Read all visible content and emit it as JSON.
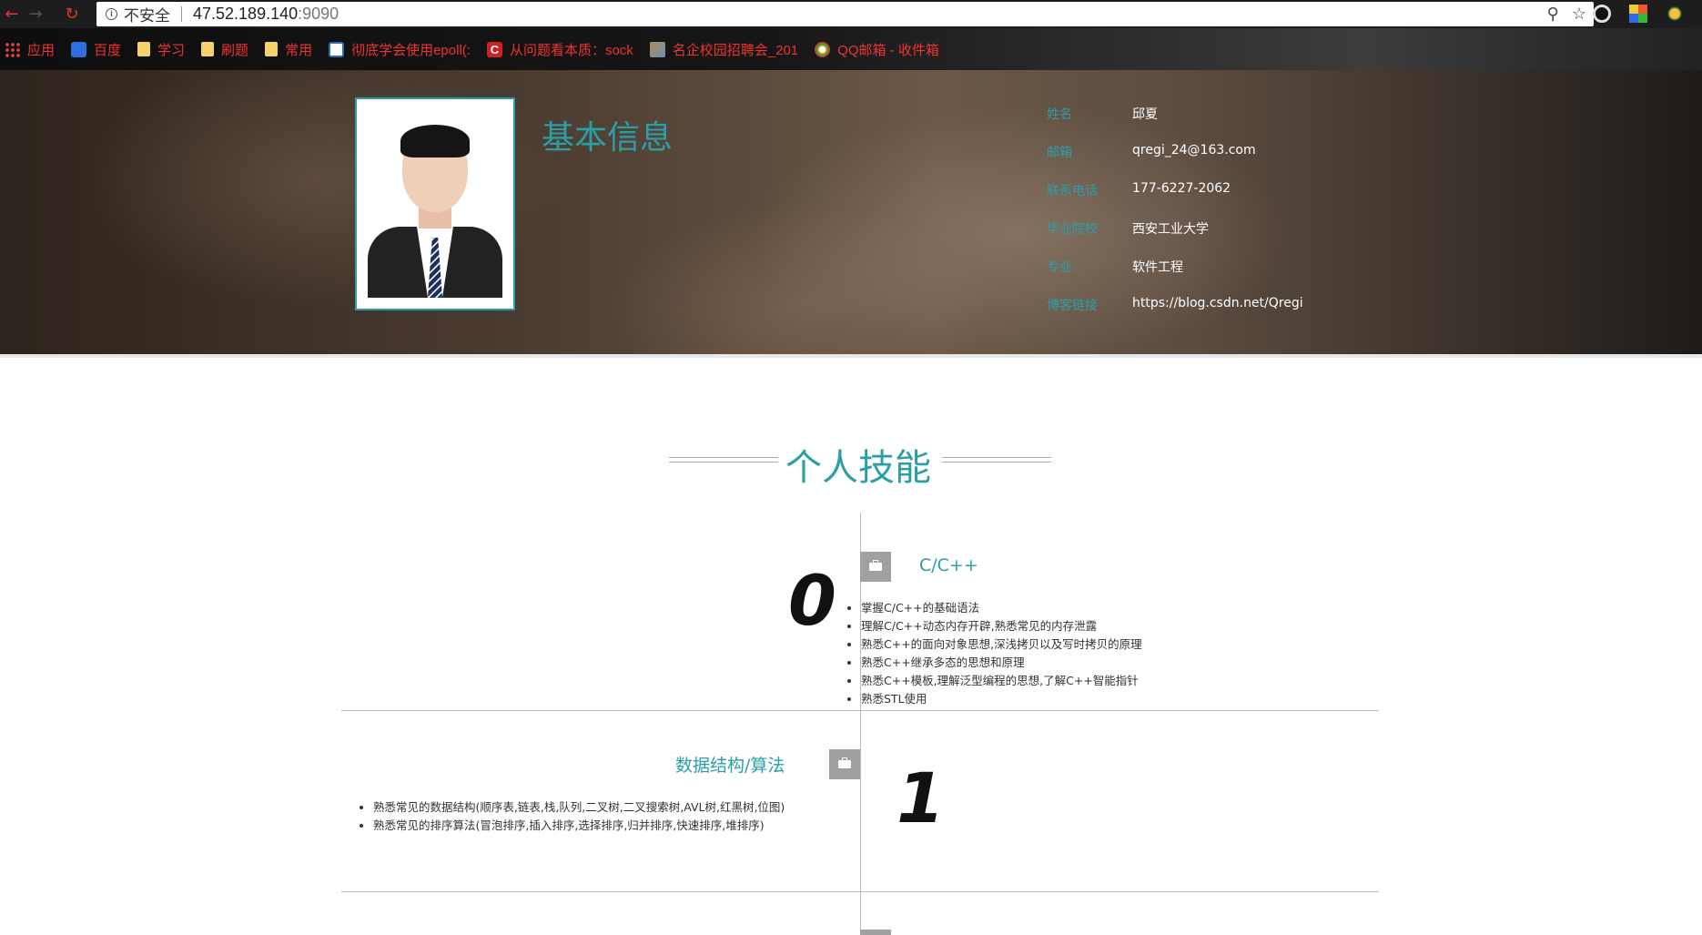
{
  "browser": {
    "insecure_label": "不安全",
    "host": "47.52.189.140",
    "port": ":9090",
    "bookmarks": [
      {
        "label": "应用",
        "icon": "apps-grid-icon"
      },
      {
        "label": "百度",
        "icon": "baidu-icon"
      },
      {
        "label": "学习",
        "icon": "folder-icon"
      },
      {
        "label": "刷题",
        "icon": "folder-icon"
      },
      {
        "label": "常用",
        "icon": "folder-icon"
      },
      {
        "label": "彻底学会使用epoll(:",
        "icon": "site-icon"
      },
      {
        "label": "从问题看本质：sock",
        "icon": "csdn-icon"
      },
      {
        "label": "名企校园招聘会_201",
        "icon": "image-icon"
      },
      {
        "label": "QQ邮箱 - 收件箱",
        "icon": "chrome-icon"
      }
    ]
  },
  "profile": {
    "section_title": "基本信息",
    "fields": [
      {
        "label": "姓名",
        "value": "邱夏"
      },
      {
        "label": "邮箱",
        "value": "qregi_24@163.com"
      },
      {
        "label": "联系电话",
        "value": "177-6227-2062"
      },
      {
        "label": "毕业院校",
        "value": "西安工业大学"
      },
      {
        "label": "专业",
        "value": "软件工程"
      },
      {
        "label": "博客链接",
        "value": "https://blog.csdn.net/Qregi"
      }
    ]
  },
  "skills": {
    "section_title": "个人技能",
    "items": [
      {
        "number": "0",
        "title": "C/C++",
        "points": [
          "掌握C/C++的基础语法",
          "理解C/C++动态内存开辟,熟悉常见的内存泄露",
          "熟悉C++的面向对象思想,深浅拷贝以及写时拷贝的原理",
          "熟悉C++继承多态的思想和原理",
          "熟悉C++模板,理解泛型编程的思想,了解C++智能指针",
          "熟悉STL使用"
        ]
      },
      {
        "number": "1",
        "title": "数据结构/算法",
        "points": [
          "熟悉常见的数据结构(顺序表,链表,栈,队列,二叉树,二叉搜索树,AVL树,红黑树,位图)",
          "熟悉常见的排序算法(冒泡排序,插入排序,选择排序,归并排序,快速排序,堆排序)"
        ]
      }
    ]
  },
  "colors": {
    "accent": "#2a9fa8",
    "bookmark_text": "#e33333"
  }
}
